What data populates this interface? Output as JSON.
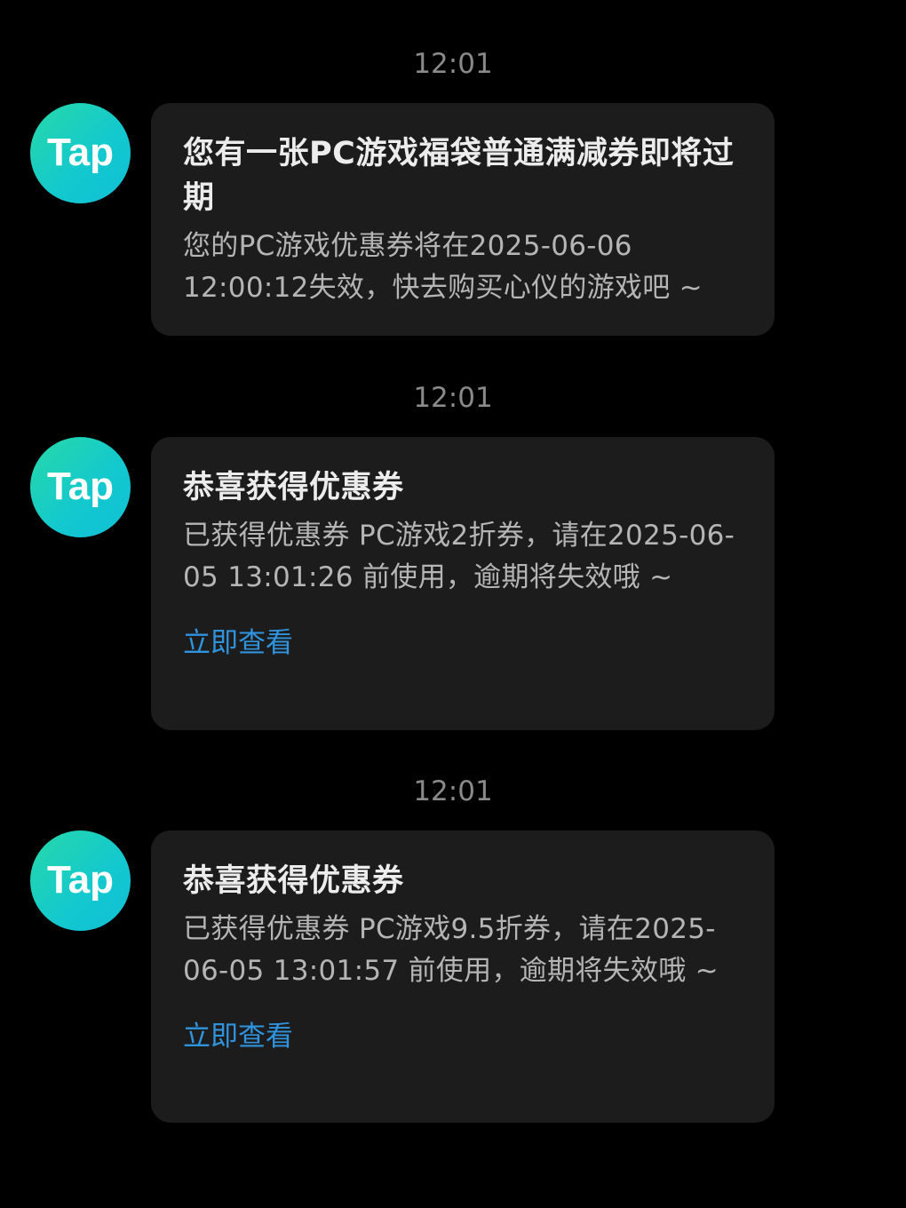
{
  "messages": [
    {
      "time": "12:01",
      "avatar_label": "Tap",
      "title": "您有一张PC游戏福袋普通满减券即将过期",
      "body": "您的PC游戏优惠券将在2025-06-06 12:00:12失效，快去购买心仪的游戏吧 ~"
    },
    {
      "time": "12:01",
      "avatar_label": "Tap",
      "title": "恭喜获得优惠券",
      "body": "已获得优惠券 PC游戏2折券，请在2025-06-05 13:01:26 前使用，逾期将失效哦 ~",
      "link": "立即查看"
    },
    {
      "time": "12:01",
      "avatar_label": "Tap",
      "title": "恭喜获得优惠券",
      "body": "已获得优惠券 PC游戏9.5折券，请在2025-06-05 13:01:57 前使用，逾期将失效哦 ~",
      "link": "立即查看"
    }
  ],
  "colors": {
    "background": "#000000",
    "card": "#1c1c1c",
    "link": "#2f93de",
    "avatar_gradient_start": "#26d9a8",
    "avatar_gradient_end": "#10c0d6"
  }
}
